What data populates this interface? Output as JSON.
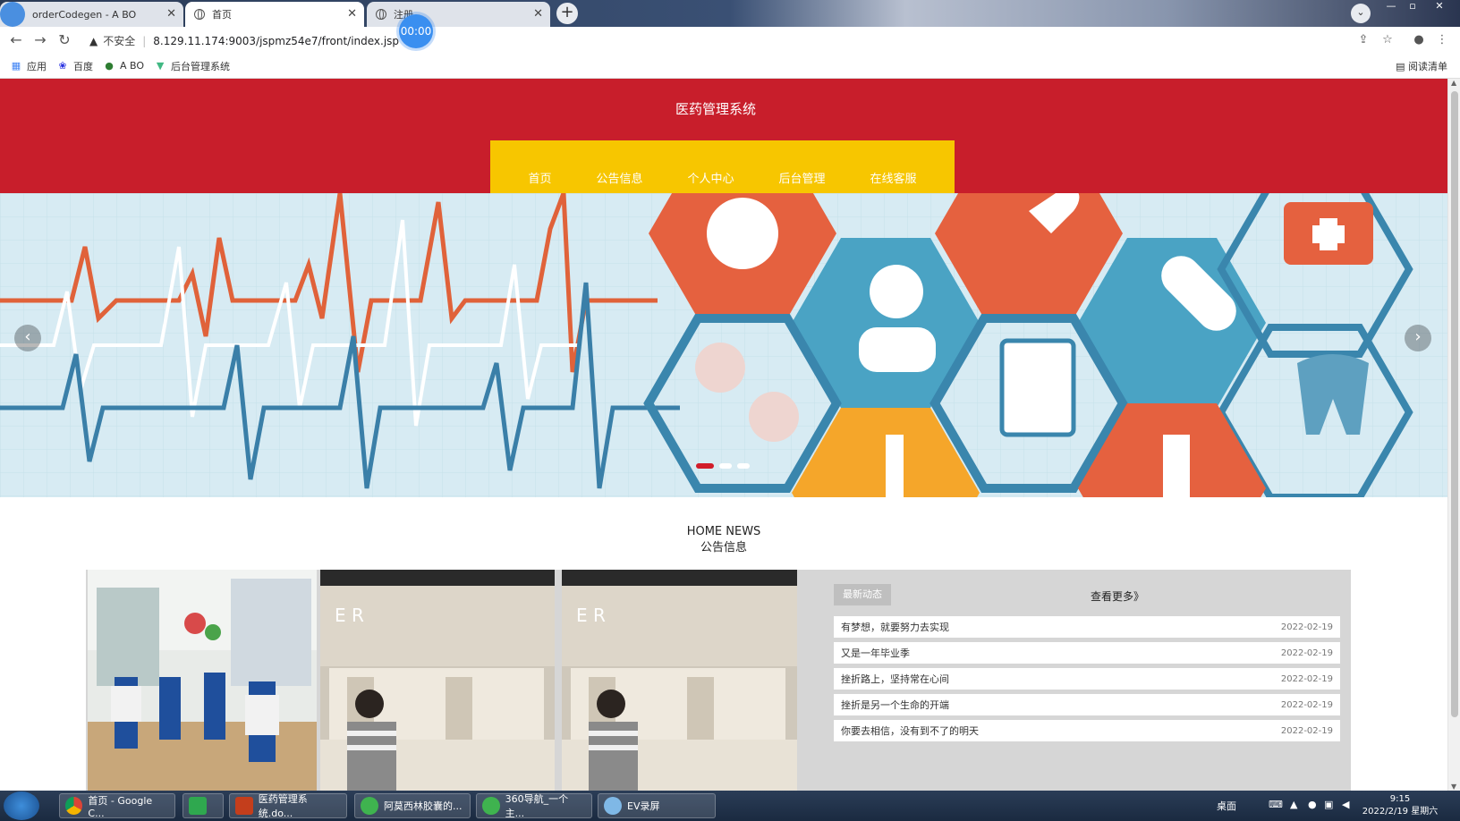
{
  "browser": {
    "tabs": [
      {
        "label": "orderCodegen - A BO"
      },
      {
        "label": "首页"
      },
      {
        "label": "注册"
      }
    ],
    "address": {
      "security_label": "不安全",
      "url": "8.129.11.174:9003/jspmz54e7/front/index.jsp"
    },
    "recorder_timer": "00:00",
    "bookmarks": [
      {
        "label": "应用"
      },
      {
        "label": "百度"
      },
      {
        "label": "A BO"
      },
      {
        "label": "后台管理系统"
      }
    ],
    "reading_list": "阅读清单"
  },
  "site": {
    "title": "医药管理系统",
    "nav": [
      {
        "label": "首页"
      },
      {
        "label": "公告信息"
      },
      {
        "label": "个人中心"
      },
      {
        "label": "后台管理"
      },
      {
        "label": "在线客服"
      }
    ]
  },
  "carousel": {
    "prev_icon": "chevron-left-icon",
    "next_icon": "chevron-right-icon",
    "slide_count": 3,
    "active_slide": 1
  },
  "news": {
    "heading_en": "HOME NEWS",
    "heading_cn": "公告信息",
    "tag": "最新动态",
    "more": "查看更多》",
    "items": [
      {
        "title": "有梦想，就要努力去实现",
        "date": "2022-02-19"
      },
      {
        "title": "又是一年毕业季",
        "date": "2022-02-19"
      },
      {
        "title": "挫折路上，坚持常在心间",
        "date": "2022-02-19"
      },
      {
        "title": "挫折是另一个生命的开端",
        "date": "2022-02-19"
      },
      {
        "title": "你要去相信，没有到不了的明天",
        "date": "2022-02-19"
      }
    ]
  },
  "taskbar": {
    "tasks": [
      {
        "label": "首页 - Google C..."
      },
      {
        "label": ""
      },
      {
        "label": "医药管理系统.do..."
      },
      {
        "label": "阿莫西林胶囊的..."
      },
      {
        "label": "360导航_一个主..."
      },
      {
        "label": "EV录屏"
      }
    ],
    "desktop_label": "桌面",
    "time": "9:15",
    "date": "2022/2/19 星期六"
  }
}
